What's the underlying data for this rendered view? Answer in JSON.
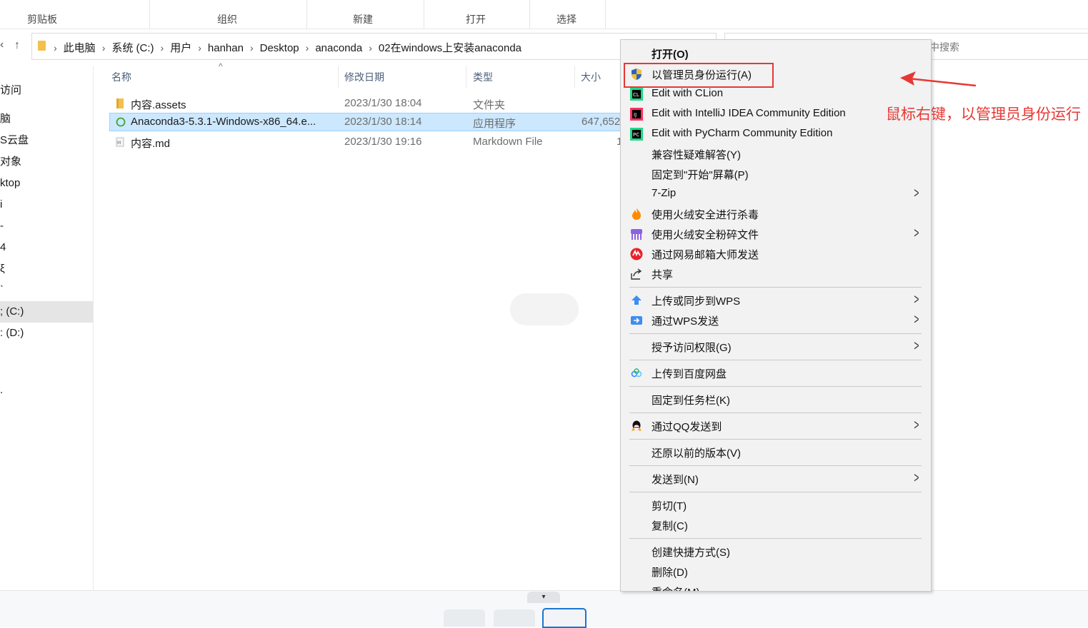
{
  "ribbon": {
    "groups": [
      "剪贴板",
      "组织",
      "新建",
      "打开",
      "选择"
    ]
  },
  "nav": {
    "back_glyph": "‹",
    "up_glyph": "↑"
  },
  "address": {
    "crumbs": [
      "此电脑",
      "系统 (C:)",
      "用户",
      "hanhan",
      "Desktop",
      "anaconda",
      "02在windows上安装anaconda"
    ],
    "sep_glyph": "›"
  },
  "search": {
    "placeholder": "中搜索"
  },
  "sidebar": {
    "items": [
      "访问",
      "脑",
      "S云盘",
      "对象",
      "ktop",
      "i",
      "-",
      "4",
      "ξ",
      "ˋ",
      "; (C:)",
      ": (D:)",
      "."
    ]
  },
  "columns": {
    "name": "名称",
    "modified": "修改日期",
    "type": "类型",
    "size": "大小",
    "sort_caret": "^"
  },
  "files": [
    {
      "name": "内容.assets",
      "modified": "2023/1/30 18:04",
      "type": "文件夹",
      "size": ""
    },
    {
      "name": "Anaconda3-5.3.1-Windows-x86_64.e...",
      "modified": "2023/1/30 18:14",
      "type": "应用程序",
      "size": "647,652"
    },
    {
      "name": "内容.md",
      "modified": "2023/1/30 19:16",
      "type": "Markdown File",
      "size": "1"
    }
  ],
  "context_menu": {
    "items": [
      {
        "label": "打开(O)",
        "icon": "none",
        "submenu": false
      },
      {
        "label": "以管理员身份运行(A)",
        "icon": "uac-shield-icon",
        "submenu": false
      },
      {
        "label": "Edit with CLion",
        "icon": "clion-icon",
        "submenu": false
      },
      {
        "label": "Edit with IntelliJ IDEA Community Edition",
        "icon": "intellij-icon",
        "submenu": false
      },
      {
        "label": "Edit with PyCharm Community Edition",
        "icon": "pycharm-icon",
        "submenu": false
      },
      {
        "label": "兼容性疑难解答(Y)",
        "icon": "none",
        "submenu": false
      },
      {
        "label": "固定到\"开始\"屏幕(P)",
        "icon": "none",
        "submenu": false
      },
      {
        "label": "7-Zip",
        "icon": "none",
        "submenu": true
      },
      {
        "label": "使用火绒安全进行杀毒",
        "icon": "huorong-icon",
        "submenu": false
      },
      {
        "label": "使用火绒安全粉碎文件",
        "icon": "shredder-icon",
        "submenu": true
      },
      {
        "label": "通过网易邮箱大师发送",
        "icon": "netease-mail-icon",
        "submenu": false
      },
      {
        "label": "共享",
        "icon": "share-icon",
        "submenu": false
      },
      {
        "label": "上传或同步到WPS",
        "icon": "wps-cloud-icon",
        "submenu": true
      },
      {
        "label": "通过WPS发送",
        "icon": "wps-send-icon",
        "submenu": true
      },
      {
        "label": "授予访问权限(G)",
        "icon": "none",
        "submenu": true
      },
      {
        "label": "上传到百度网盘",
        "icon": "baidu-netdisk-icon",
        "submenu": false
      },
      {
        "label": "固定到任务栏(K)",
        "icon": "none",
        "submenu": false
      },
      {
        "label": "通过QQ发送到",
        "icon": "qq-icon",
        "submenu": true
      },
      {
        "label": "还原以前的版本(V)",
        "icon": "none",
        "submenu": false
      },
      {
        "label": "发送到(N)",
        "icon": "none",
        "submenu": true
      },
      {
        "label": "剪切(T)",
        "icon": "none",
        "submenu": false
      },
      {
        "label": "复制(C)",
        "icon": "none",
        "submenu": false
      },
      {
        "label": "创建快捷方式(S)",
        "icon": "none",
        "submenu": false
      },
      {
        "label": "删除(D)",
        "icon": "none",
        "submenu": false
      },
      {
        "label": "重命名(M)",
        "icon": "none",
        "submenu": false
      }
    ],
    "arrow_glyph": ">"
  },
  "annotation": {
    "text": "鼠标右键，以管理员身份运行",
    "color": "#e53935"
  },
  "bottom": {
    "collapse_glyph": "▾"
  }
}
